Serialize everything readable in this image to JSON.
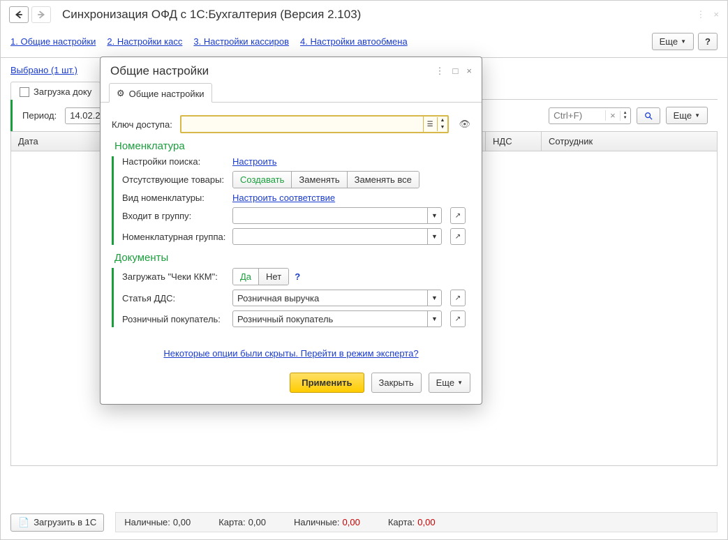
{
  "header": {
    "title": "Синхронизация ОФД с 1С:Бухгалтерия (Версия 2.103)"
  },
  "tabs": {
    "t1": "1. Общие настройки",
    "t2": "2. Настройки касс",
    "t3": "3. Настройки кассиров",
    "t4": "4. Настройки автообмена",
    "more": "Еще",
    "help": "?"
  },
  "selected": "Выбрано (1 шт.)",
  "innerTab": "Загрузка доку",
  "toolbar": {
    "period_label": "Период:",
    "period_value": "14.02.2",
    "search_placeholder": "Ctrl+F)",
    "more": "Еще"
  },
  "table": {
    "col_date": "Дата",
    "col_nds": "НДС",
    "col_emp": "Сотрудник"
  },
  "bottom": {
    "load_btn": "Загрузить в 1С",
    "cash_label": "Наличные:",
    "cash_val": "0,00",
    "card_label": "Карта:",
    "card_val": "0,00",
    "cash2_label": "Наличные:",
    "cash2_val": "0,00",
    "card2_label": "Карта:",
    "card2_val": "0,00"
  },
  "dialog": {
    "title": "Общие настройки",
    "tab_label": "Общие настройки",
    "key_label": "Ключ доступа:",
    "section_nomenclature": "Номенклатура",
    "search_settings_label": "Настройки поиска:",
    "search_settings_link": "Настроить",
    "missing_goods_label": "Отсутствующие товары:",
    "seg_create": "Создавать",
    "seg_replace": "Заменять",
    "seg_replace_all": "Заменять все",
    "nomenclature_type_label": "Вид номенклатуры:",
    "nomenclature_type_link": "Настроить соответствие",
    "in_group_label": "Входит в группу:",
    "nomenclature_group_label": "Номенклатурная группа:",
    "section_documents": "Документы",
    "load_checks_label": "Загружать \"Чеки ККМ\":",
    "seg_yes": "Да",
    "seg_no": "Нет",
    "dds_label": "Статья ДДС:",
    "dds_value": "Розничная выручка",
    "retail_buyer_label": "Розничный покупатель:",
    "retail_buyer_value": "Розничный покупатель",
    "expert_link": "Некоторые опции были скрыты. Перейти в режим эксперта?",
    "apply": "Применить",
    "close": "Закрыть",
    "more": "Еще"
  }
}
